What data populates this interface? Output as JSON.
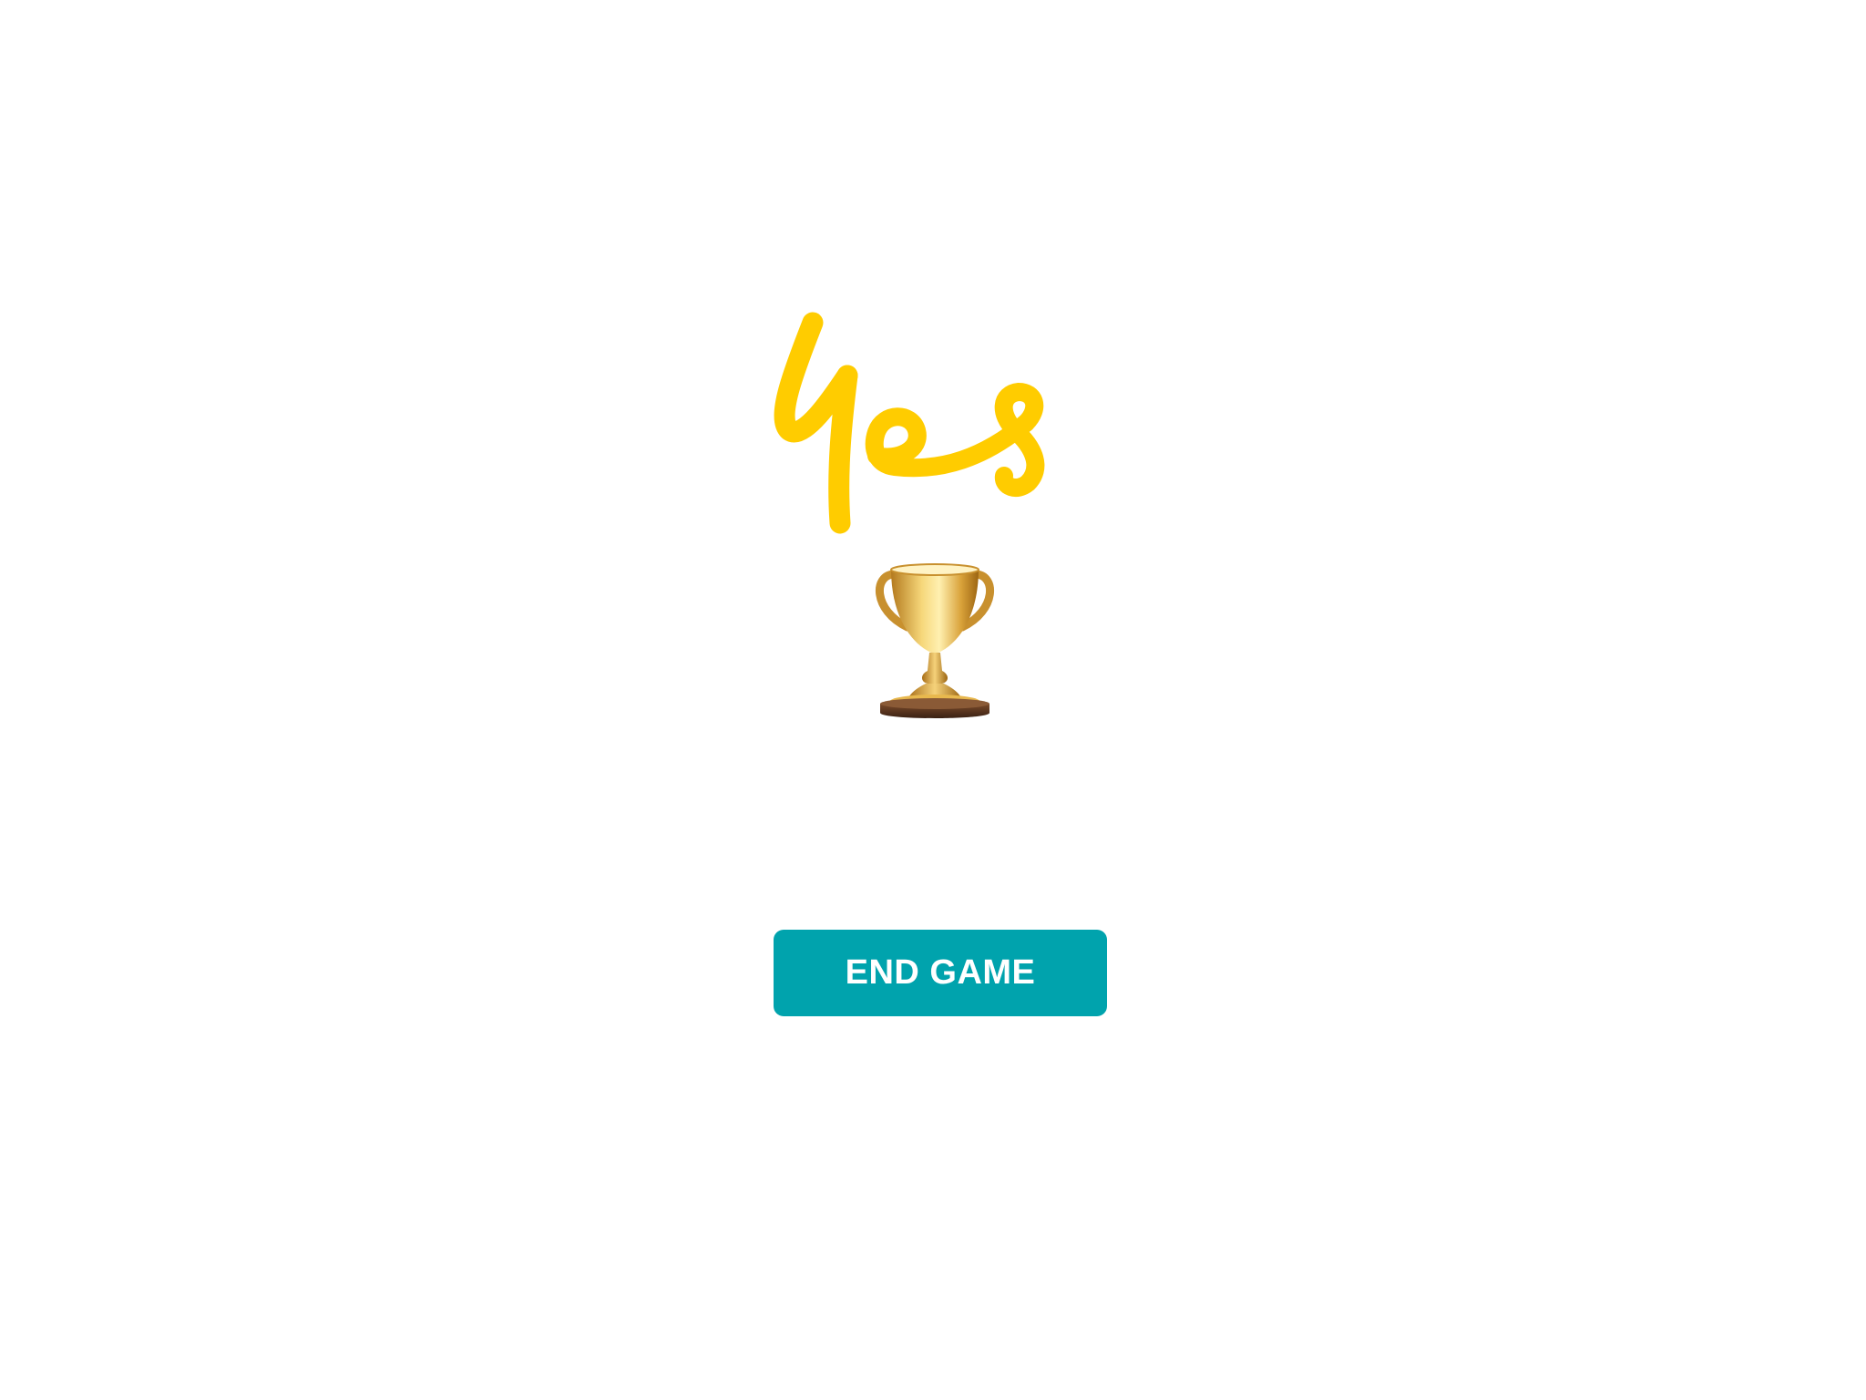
{
  "app": {
    "background_color": "#ffffff"
  },
  "brand": {
    "logo_text": "yes",
    "logo_color": "#FFCC00",
    "logo_icon": "optus-yes-logo"
  },
  "result": {
    "icon": "trophy-icon"
  },
  "actions": {
    "end_game_label": "END GAME",
    "end_game_color": "#00A3AD"
  }
}
